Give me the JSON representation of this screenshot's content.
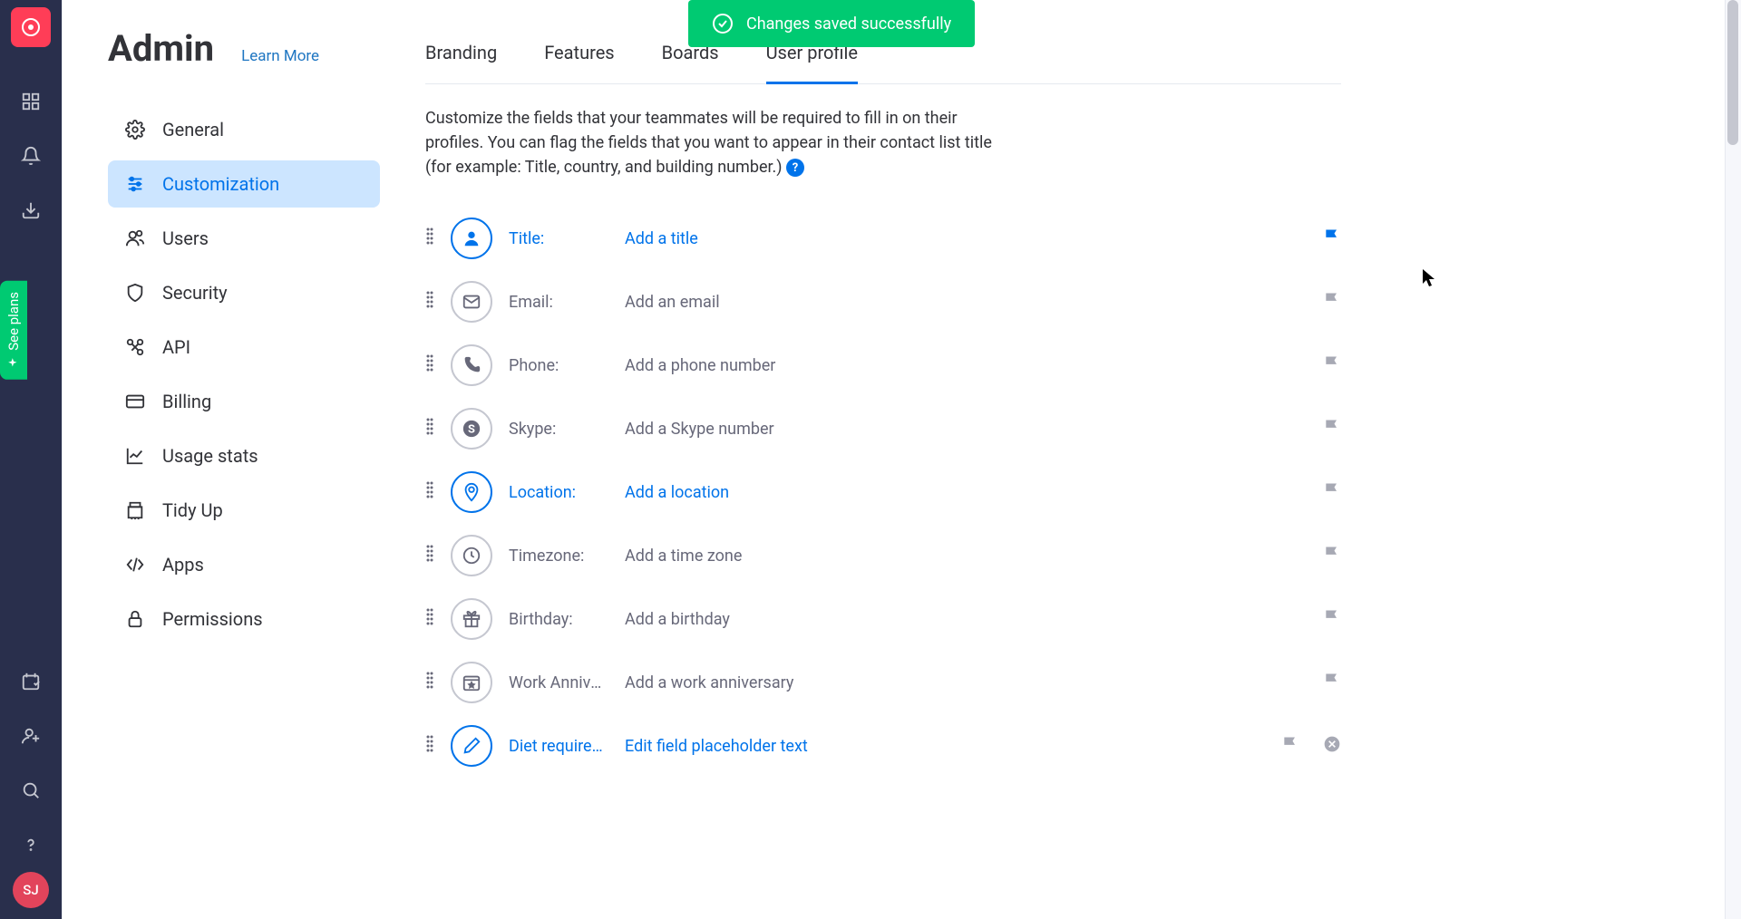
{
  "rail": {
    "avatar": "SJ",
    "see_plans": "See plans"
  },
  "sidebar": {
    "title": "Admin",
    "learn_more": "Learn More",
    "items": [
      {
        "label": "General"
      },
      {
        "label": "Customization"
      },
      {
        "label": "Users"
      },
      {
        "label": "Security"
      },
      {
        "label": "API"
      },
      {
        "label": "Billing"
      },
      {
        "label": "Usage stats"
      },
      {
        "label": "Tidy Up"
      },
      {
        "label": "Apps"
      },
      {
        "label": "Permissions"
      }
    ]
  },
  "tabs": [
    {
      "label": "Branding"
    },
    {
      "label": "Features"
    },
    {
      "label": "Boards"
    },
    {
      "label": "User profile"
    }
  ],
  "description": "Customize the fields that your teammates will be required to fill in on their profiles. You can flag the fields that you want to appear in their contact list title (for example: Title, country, and building number.)",
  "help": "?",
  "toast": "Changes saved successfully",
  "fields": [
    {
      "label": "Title:",
      "placeholder": "Add a title"
    },
    {
      "label": "Email:",
      "placeholder": "Add an email"
    },
    {
      "label": "Phone:",
      "placeholder": "Add a phone number"
    },
    {
      "label": "Skype:",
      "placeholder": "Add a Skype number"
    },
    {
      "label": "Location:",
      "placeholder": "Add a location"
    },
    {
      "label": "Timezone:",
      "placeholder": "Add a time zone"
    },
    {
      "label": "Birthday:",
      "placeholder": "Add a birthday"
    },
    {
      "label": "Work Annive…",
      "placeholder": "Add a work anniversary"
    },
    {
      "label": "Diet require…",
      "placeholder": "Edit field placeholder text"
    }
  ]
}
